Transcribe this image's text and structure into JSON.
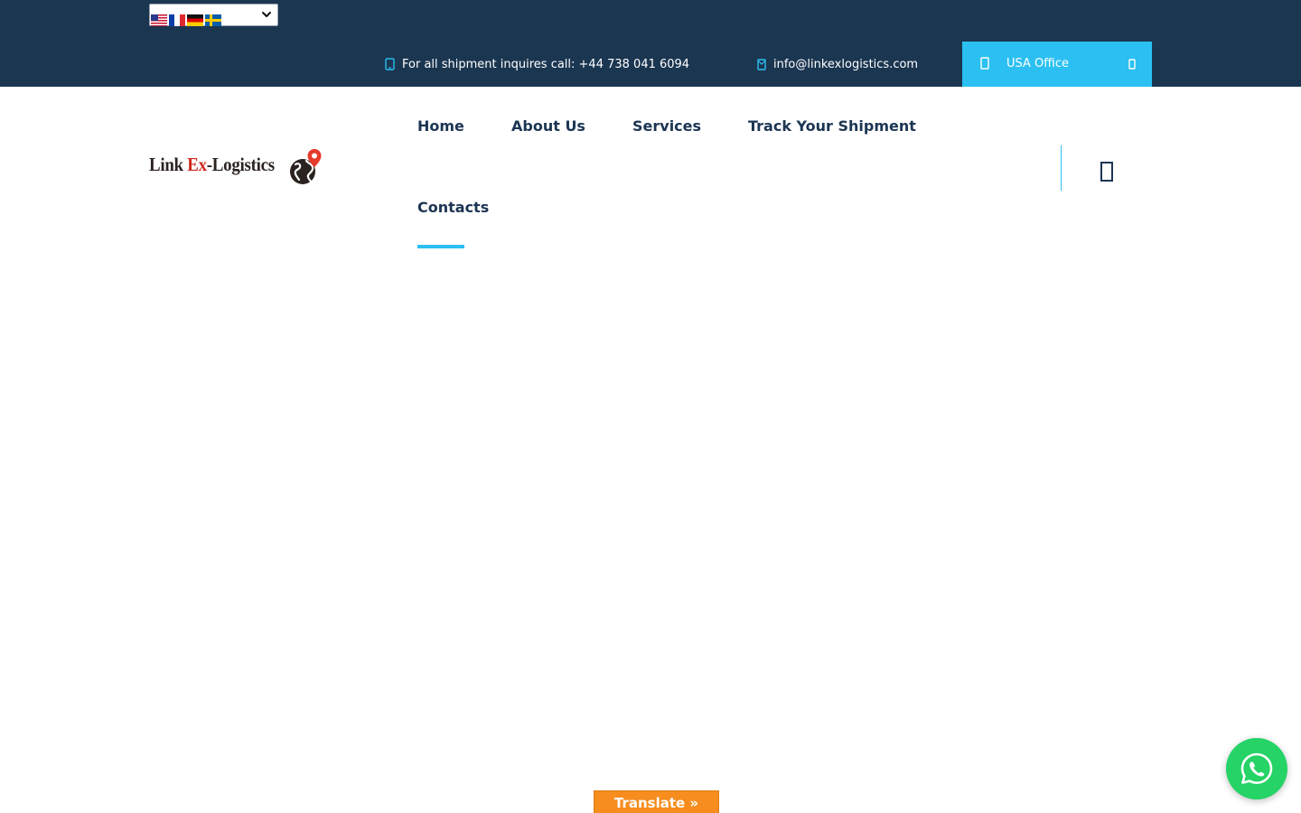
{
  "header": {
    "language_flags": [
      "us-flag",
      "fr-flag",
      "de-flag",
      "se-flag"
    ],
    "phone_text": "For all shipment inquires call: +44 738 041 6094",
    "email_text": "info@linkexlogistics.com",
    "office_label": "USA Office"
  },
  "logo": {
    "part1": "Link ",
    "part2": "Ex",
    "part3": "-Logistics"
  },
  "nav": {
    "items": [
      {
        "label": "Home"
      },
      {
        "label": "About Us"
      },
      {
        "label": "Services"
      },
      {
        "label": "Track Your Shipment"
      },
      {
        "label": "Contacts"
      }
    ],
    "active": "Home"
  },
  "translate_label": "Translate »",
  "colors": {
    "topbar": "#1b3651",
    "accent": "#2bc0f1",
    "nav_text": "#1c3553",
    "translate_bg": "#f68d1e",
    "whatsapp": "#25d366"
  },
  "icons": [
    "phone-icon",
    "envelope-icon",
    "map-pin-icon",
    "arrow-right-icon",
    "search-icon",
    "whatsapp-icon",
    "chevron-down-icon",
    "globe-pin-icon"
  ]
}
